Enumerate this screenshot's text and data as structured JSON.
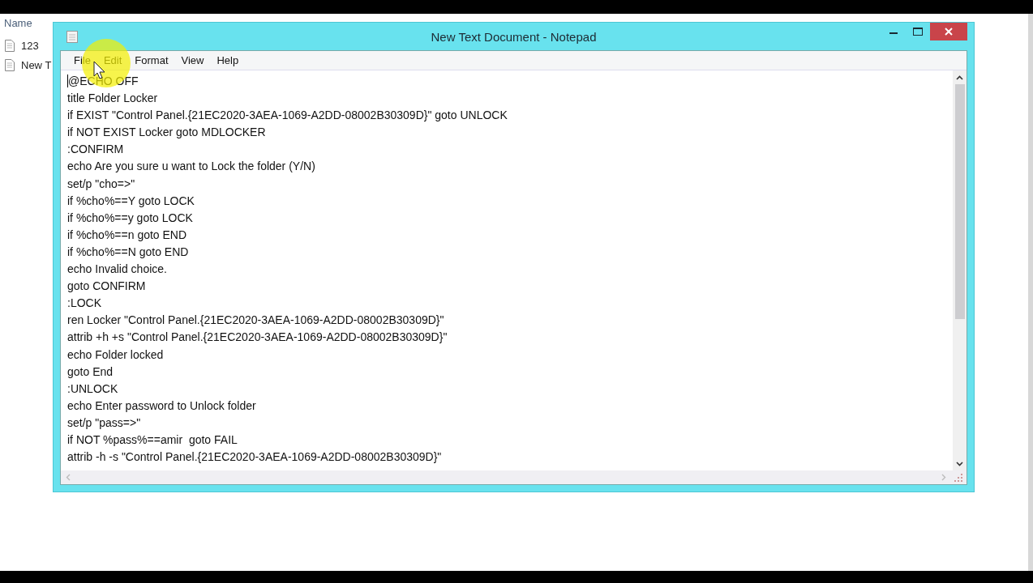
{
  "explorer": {
    "column": "Name",
    "files": [
      {
        "name": "123"
      },
      {
        "name": "New T"
      }
    ]
  },
  "notepad": {
    "title": "New Text Document - Notepad",
    "menu": [
      "File",
      "Edit",
      "Format",
      "View",
      "Help"
    ],
    "lines": [
      "@ECHO OFF",
      "title Folder Locker",
      "if EXIST \"Control Panel.{21EC2020-3AEA-1069-A2DD-08002B30309D}\" goto UNLOCK",
      "if NOT EXIST Locker goto MDLOCKER",
      ":CONFIRM",
      "echo Are you sure u want to Lock the folder (Y/N)",
      "set/p \"cho=>\"",
      "if %cho%==Y goto LOCK",
      "if %cho%==y goto LOCK",
      "if %cho%==n goto END",
      "if %cho%==N goto END",
      "echo Invalid choice.",
      "goto CONFIRM",
      ":LOCK",
      "ren Locker \"Control Panel.{21EC2020-3AEA-1069-A2DD-08002B30309D}\"",
      "attrib +h +s \"Control Panel.{21EC2020-3AEA-1069-A2DD-08002B30309D}\"",
      "echo Folder locked",
      "goto End",
      ":UNLOCK",
      "echo Enter password to Unlock folder",
      "set/p \"pass=>\"",
      "if NOT %pass%==amir  goto FAIL",
      "attrib -h -s \"Control Panel.{21EC2020-3AEA-1069-A2DD-08002B30309D}\""
    ]
  }
}
